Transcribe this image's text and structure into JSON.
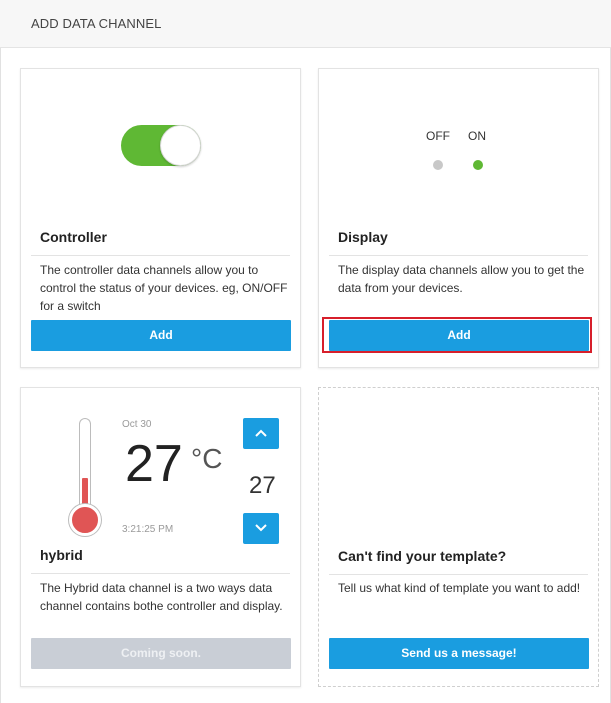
{
  "header": {
    "title": "ADD DATA CHANNEL"
  },
  "cards": {
    "controller": {
      "title": "Controller",
      "description": "The controller data channels allow you to control the status of your devices. eg, ON/OFF for a switch",
      "button_label": "Add",
      "toggle_state": "on"
    },
    "display": {
      "title": "Display",
      "off_label": "OFF",
      "on_label": "ON",
      "description": "The display data channels allow you to get the data from your devices.",
      "button_label": "Add"
    },
    "hybrid": {
      "title": "hybrid",
      "date": "Oct 30",
      "temperature": "27",
      "unit": "°C",
      "time": "3:21:25 PM",
      "set_value": "27",
      "description": "The Hybrid data channel is a two ways data channel contains bothe controller and display.",
      "button_label": "Coming soon."
    },
    "template": {
      "title": "Can't find your template?",
      "description": "Tell us what kind of template you want to add!",
      "button_label": "Send us a message!"
    }
  },
  "colors": {
    "accent": "#1a9de0",
    "toggle_on": "#5fb834",
    "dot_off": "#c8c8c8",
    "dot_on": "#5fb834",
    "thermometer": "#e05555",
    "disabled_button": "#c9ced6",
    "highlight": "#d71f2b"
  }
}
